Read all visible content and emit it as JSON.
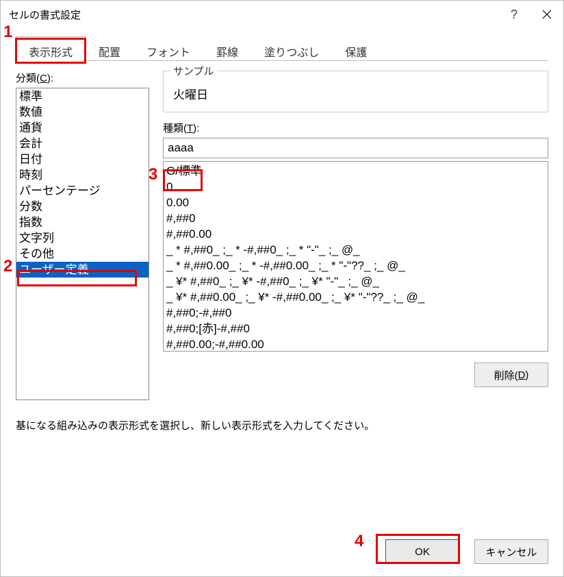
{
  "window": {
    "title": "セルの書式設定"
  },
  "tabs": [
    {
      "label": "表示形式",
      "active": true
    },
    {
      "label": "配置",
      "active": false
    },
    {
      "label": "フォント",
      "active": false
    },
    {
      "label": "罫線",
      "active": false
    },
    {
      "label": "塗りつぶし",
      "active": false
    },
    {
      "label": "保護",
      "active": false
    }
  ],
  "category": {
    "label_prefix": "分類(",
    "label_u": "C",
    "label_suffix": "):",
    "items": [
      {
        "label": "標準",
        "selected": false
      },
      {
        "label": "数値",
        "selected": false
      },
      {
        "label": "通貨",
        "selected": false
      },
      {
        "label": "会計",
        "selected": false
      },
      {
        "label": "日付",
        "selected": false
      },
      {
        "label": "時刻",
        "selected": false
      },
      {
        "label": "パーセンテージ",
        "selected": false
      },
      {
        "label": "分数",
        "selected": false
      },
      {
        "label": "指数",
        "selected": false
      },
      {
        "label": "文字列",
        "selected": false
      },
      {
        "label": "その他",
        "selected": false
      },
      {
        "label": "ユーザー定義",
        "selected": true
      }
    ]
  },
  "sample": {
    "legend": "サンプル",
    "value": "火曜日"
  },
  "type": {
    "label_prefix": "種類(",
    "label_u": "T",
    "label_suffix": "):",
    "value": "aaaa",
    "items": [
      "G/標準",
      "0",
      "0.00",
      "#,##0",
      "#,##0.00",
      "_ * #,##0_ ;_ * -#,##0_ ;_ * \"-\"_ ;_ @_",
      "_ * #,##0.00_ ;_ * -#,##0.00_ ;_ * \"-\"??_ ;_ @_",
      "_ ¥* #,##0_ ;_ ¥* -#,##0_ ;_ ¥* \"-\"_ ;_ @_",
      "_ ¥* #,##0.00_ ;_ ¥* -#,##0.00_ ;_ ¥* \"-\"??_ ;_ @_",
      "#,##0;-#,##0",
      "#,##0;[赤]-#,##0",
      "#,##0.00;-#,##0.00"
    ]
  },
  "delete": {
    "label_prefix": "削除(",
    "label_u": "D",
    "label_suffix": ")"
  },
  "hint": "基になる組み込みの表示形式を選択し、新しい表示形式を入力してください。",
  "footer": {
    "ok": "OK",
    "cancel": "キャンセル"
  },
  "annotations": {
    "n1": "1",
    "n2": "2",
    "n3": "3",
    "n4": "4"
  }
}
